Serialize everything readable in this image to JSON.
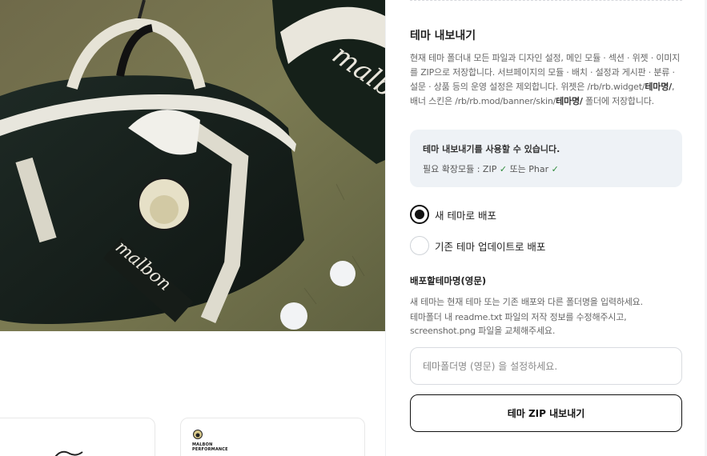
{
  "left": {
    "hero_alt": "golf bag photo",
    "brand_lines": [
      "MALBON",
      "PERFORMANCE"
    ]
  },
  "panel": {
    "title": "테마 내보내기",
    "desc": {
      "p1": "현재 테마 폴더내 모든 파일과 디자인 설정, 메인 모듈 · 섹션 · 위젯 · 이미지를 ZIP으로 저장합니다. 서브페이지의 모듈 · 배치 · 설정과 게시판 · 분류 · 설문 · 상품 등의 운영 설정은 제외합니다. 위젯은 /rb/rb.widget/",
      "b1": "테마명/",
      "p2": ", 배너 스킨은 /rb/rb.mod/banner/skin/",
      "b2": "테마명/",
      "p3": " 폴더에 저장합니다."
    },
    "notice": {
      "title": "테마 내보내기를 사용할 수 있습니다.",
      "sub_prefix": "필요 확장모듈 : ZIP",
      "sub_middle": "또는 Phar",
      "check_glyph": "✓"
    },
    "radios": [
      {
        "label": "새 테마로 배포",
        "selected": true
      },
      {
        "label": "기존 테마 업데이트로 배포",
        "selected": false
      }
    ],
    "field": {
      "label": "배포할테마명(영문)",
      "help1": "새 테마는 현재 테마 또는 기존 배포와 다른 폴더명을 입력하세요.",
      "help2": "테마폴더 내 readme.txt 파일의 저작 정보를 수정해주시고, screenshot.png 파일을 교체해주세요.",
      "placeholder": "테마폴더명 (영문) 을 설정하세요.",
      "value": ""
    },
    "export_button": "테마 ZIP 내보내기"
  }
}
